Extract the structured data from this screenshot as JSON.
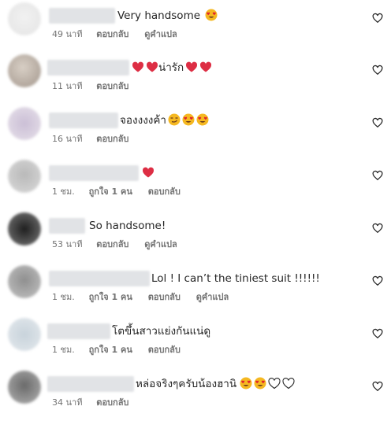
{
  "comments": [
    {
      "text": "Very handsome",
      "emojis": [
        "heart-eyes"
      ],
      "time": "49 นาที",
      "likes": "",
      "reply_label": "ตอบกลับ",
      "translate_label": "ดูคำแปล"
    },
    {
      "text": "น่ารัก",
      "emojis": [
        "red-heart",
        "red-heart",
        "red-heart",
        "red-heart"
      ],
      "time": "11 นาที",
      "likes": "",
      "reply_label": "ตอบกลับ",
      "translate_label": ""
    },
    {
      "text": "จองงงงค้า",
      "emojis": [
        "smirk",
        "heart-eyes",
        "heart-eyes"
      ],
      "time": "16 นาที",
      "likes": "",
      "reply_label": "ตอบกลับ",
      "translate_label": ""
    },
    {
      "text": "",
      "emojis": [
        "red-heart"
      ],
      "time": "1 ชม.",
      "likes": "ถูกใจ 1 คน",
      "reply_label": "ตอบกลับ",
      "translate_label": ""
    },
    {
      "text": "So handsome!",
      "emojis": [],
      "time": "53 นาที",
      "likes": "",
      "reply_label": "ตอบกลับ",
      "translate_label": "ดูคำแปล"
    },
    {
      "text": "Lol ! I can’t the tiniest suit !!!!!!",
      "emojis": [],
      "time": "1 ชม.",
      "likes": "ถูกใจ 1 คน",
      "reply_label": "ตอบกลับ",
      "translate_label": "ดูคำแปล"
    },
    {
      "text": "โตขึ้นสาวแย่งกันแน่ดู",
      "emojis": [],
      "time": "1 ชม.",
      "likes": "ถูกใจ 1 คน",
      "reply_label": "ตอบกลับ",
      "translate_label": ""
    },
    {
      "text": "หล่อจริงๆครับน้องฮานิ",
      "emojis": [
        "heart-eyes",
        "heart-eyes",
        "white-heart",
        "white-heart"
      ],
      "time": "34 นาที",
      "likes": "",
      "reply_label": "ตอบกลับ",
      "translate_label": ""
    }
  ]
}
